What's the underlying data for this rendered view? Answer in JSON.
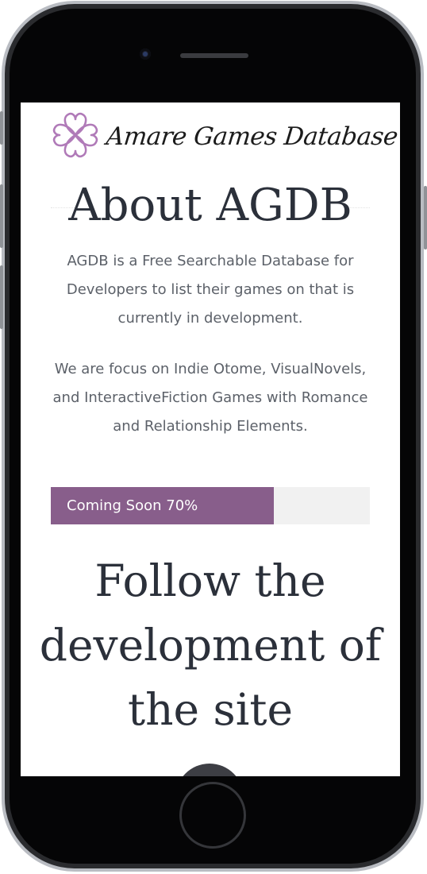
{
  "site": {
    "logo_text": "Amare Games Database"
  },
  "about": {
    "title": "About AGDB",
    "paragraph1": "AGDB is a Free Searchable Database for Developers to list their games on that is currently in development.",
    "paragraph2": "We are focus on Indie Otome, VisualNovels, and InteractiveFiction Games with Romance and Relationship Elements."
  },
  "progress": {
    "label": "Coming Soon 70%",
    "value": 0.7,
    "fill_color": "#885e8b",
    "track_color": "#f1f1f1"
  },
  "follow": {
    "heading": "Follow the development of the site"
  },
  "colors": {
    "heading": "#2b303a",
    "body_text": "#5c6169",
    "logo_accent": "#b07ab8"
  },
  "icons": {
    "logo": "heart-clover-icon",
    "scroll_top": "scroll-top-icon"
  }
}
